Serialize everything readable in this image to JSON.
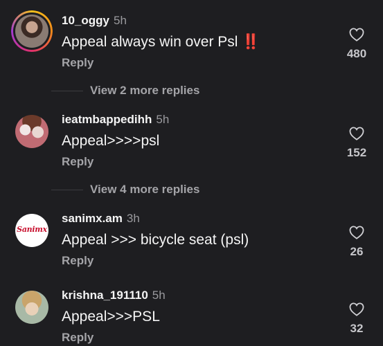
{
  "comments": [
    {
      "username": "10_oggy",
      "time": "5h",
      "text": "Appeal always win over Psl ",
      "emoji": "‼️",
      "reply_label": "Reply",
      "likes": "480",
      "avatar_icon": "user-avatar-story"
    },
    {
      "username": "ieatmbappedihh",
      "time": "5h",
      "text": "Appeal>>>>psl",
      "reply_label": "Reply",
      "likes": "152",
      "avatar_icon": "user-avatar-anime"
    },
    {
      "username": "sanimx.am",
      "time": "3h",
      "text": "Appeal >>> bicycle seat (psl)",
      "reply_label": "Reply",
      "likes": "26",
      "avatar_icon": "user-avatar-logo",
      "avatar_text": "Sanimx"
    },
    {
      "username": "krishna_191110",
      "time": "5h",
      "text": "Appeal>>>PSL",
      "reply_label": "Reply",
      "likes": "32",
      "avatar_icon": "user-avatar-face"
    }
  ],
  "view_more": [
    {
      "label": "View 2 more replies"
    },
    {
      "label": "View 4 more replies"
    }
  ],
  "colors": {
    "background": "#1e1e21",
    "text": "#f5f5f5",
    "muted": "#a4a4a8",
    "alert": "#e5262b"
  }
}
